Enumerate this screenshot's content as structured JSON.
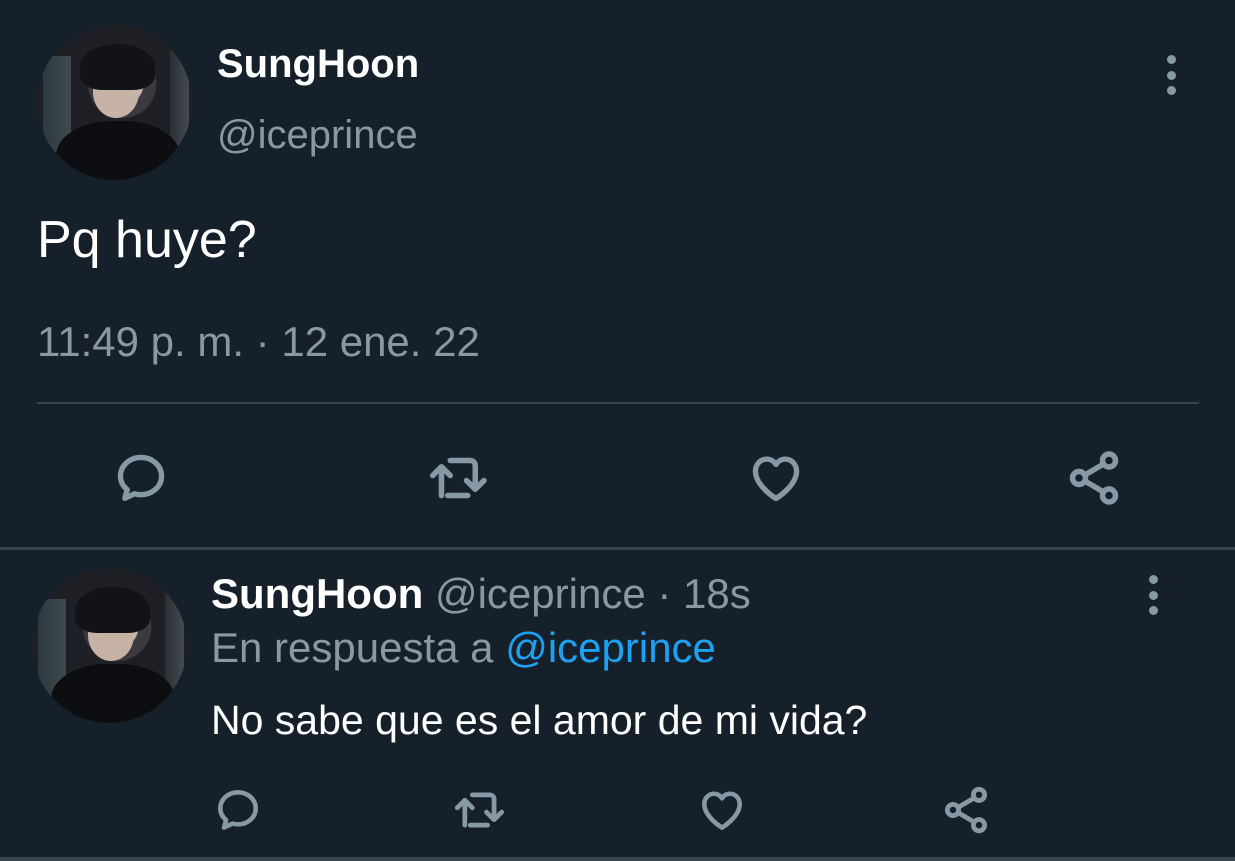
{
  "main_tweet": {
    "author_name": "SungHoon",
    "author_handle": "@iceprince",
    "text": "Pq huye?",
    "timestamp": "11:49 p. m. · 12 ene. 22",
    "actions": [
      {
        "name": "reply",
        "icon": "reply-icon"
      },
      {
        "name": "retweet",
        "icon": "retweet-icon"
      },
      {
        "name": "like",
        "icon": "heart-icon"
      },
      {
        "name": "share",
        "icon": "share-icon"
      }
    ]
  },
  "reply_tweet": {
    "author_name": "SungHoon",
    "author_handle": "@iceprince",
    "separator": "·",
    "age": "18s",
    "reply_to_prefix": "En respuesta a",
    "reply_to_handle": "@iceprince",
    "text": "No sabe que es el amor de mi vida?"
  },
  "colors": {
    "background": "#15202b",
    "text_primary": "#ffffff",
    "text_secondary": "#8899a6",
    "link": "#1da1f2",
    "divider": "#38444d"
  }
}
